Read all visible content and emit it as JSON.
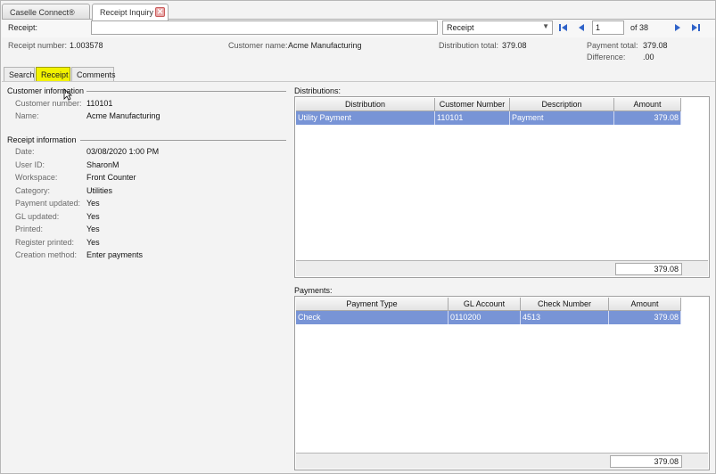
{
  "tabs": {
    "connect_label": "Caselle Connect®",
    "inquiry_label": "Receipt Inquiry",
    "close_glyph": "✕"
  },
  "header": {
    "receipt_label": "Receipt:",
    "receipt_value": "",
    "type_selected": "Receipt",
    "page_value": "1",
    "page_of": "of 38"
  },
  "summary": {
    "receipt_number_label": "Receipt number:",
    "receipt_number": "1.003578",
    "customer_name_label": "Customer name:",
    "customer_name": "Acme Manufacturing",
    "distribution_total_label": "Distribution total:",
    "distribution_total": "379.08",
    "payment_total_label": "Payment total:",
    "payment_total": "379.08",
    "difference_label": "Difference:",
    "difference": ".00"
  },
  "subtabs": {
    "search": "Search",
    "receipt": "Receipt",
    "comments": "Comments"
  },
  "customer_info": {
    "title": "Customer information",
    "customer_number_label": "Customer number:",
    "customer_number": "110101",
    "name_label": "Name:",
    "name": "Acme Manufacturing"
  },
  "receipt_info": {
    "title": "Receipt information",
    "date_label": "Date:",
    "date": "03/08/2020   1:00 PM",
    "user_label": "User ID:",
    "user": "SharonM",
    "workspace_label": "Workspace:",
    "workspace": "Front Counter",
    "category_label": "Category:",
    "category": "Utilities",
    "payment_updated_label": "Payment updated:",
    "payment_updated": "Yes",
    "gl_updated_label": "GL updated:",
    "gl_updated": "Yes",
    "printed_label": "Printed:",
    "printed": "Yes",
    "register_printed_label": "Register printed:",
    "register_printed": "Yes",
    "creation_method_label": "Creation method:",
    "creation_method": "Enter payments"
  },
  "distributions": {
    "title": "Distributions:",
    "headers": [
      "Distribution",
      "Customer Number",
      "Description",
      "Amount"
    ],
    "rows": [
      [
        "Utility Payment",
        "110101",
        "Payment",
        "379.08"
      ]
    ],
    "total": "379.08"
  },
  "payments": {
    "title": "Payments:",
    "headers": [
      "Payment Type",
      "GL Account",
      "Check Number",
      "Amount"
    ],
    "rows": [
      [
        "Check",
        "0110200",
        "4513",
        "379.08"
      ]
    ],
    "total": "379.08"
  },
  "colors": {
    "selected_row": "#7894d6",
    "highlight_tab": "#f2f200",
    "nav_blue": "#2f63c9"
  },
  "icons": [
    "first-page-icon",
    "prev-page-icon",
    "next-page-icon",
    "last-page-icon",
    "close-icon",
    "dropdown-arrow-icon",
    "mouse-cursor-icon"
  ]
}
